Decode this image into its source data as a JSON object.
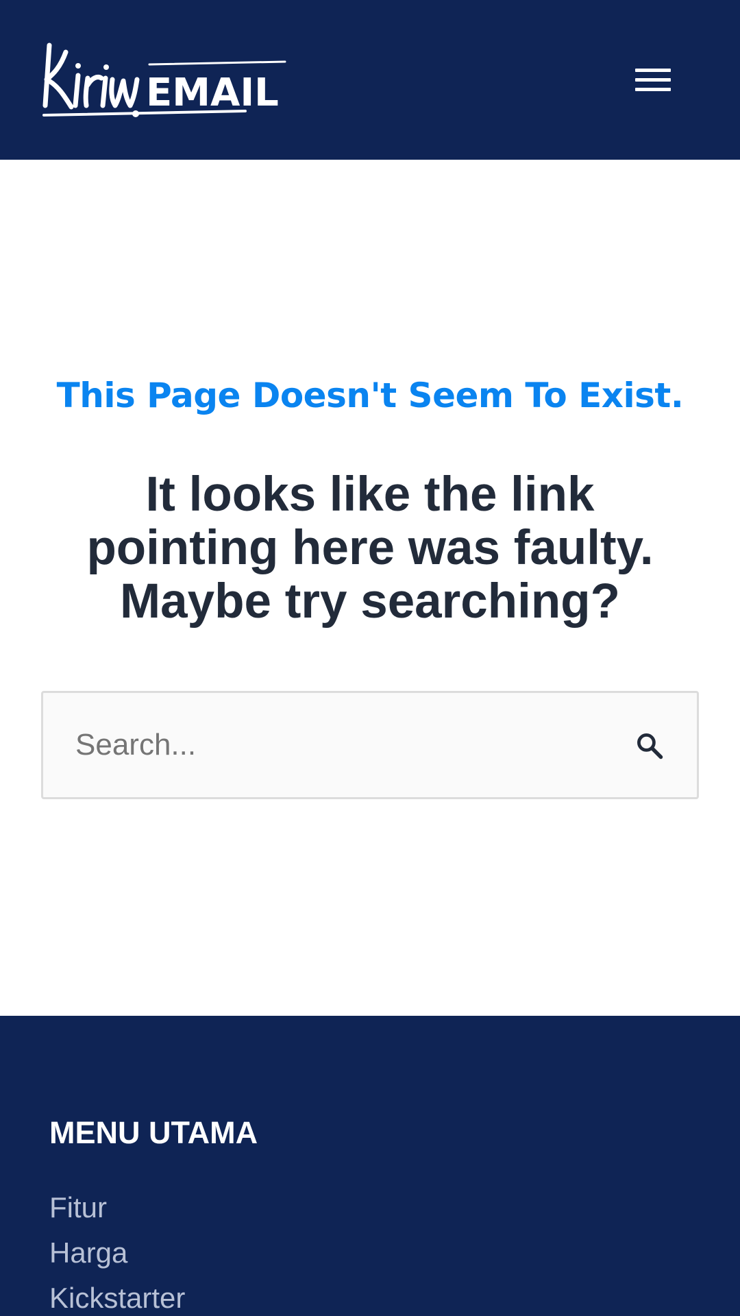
{
  "header": {
    "logo_text": "KirimEMAIL",
    "menu_icon": "hamburger-menu-icon"
  },
  "main": {
    "error_title": "This Page Doesn't Seem To Exist.",
    "error_message": "It looks like the link pointing here was faulty. Maybe try searching?",
    "search": {
      "placeholder": "Search...",
      "value": "",
      "icon": "search-icon"
    }
  },
  "footer": {
    "heading": "MENU UTAMA",
    "links": [
      {
        "label": "Fitur"
      },
      {
        "label": "Harga"
      },
      {
        "label": "Kickstarter"
      }
    ]
  },
  "colors": {
    "navy": "#0f2455",
    "accent_blue": "#0a84f0",
    "heading_dark": "#222b3a",
    "footer_link": "#b8c1d6"
  }
}
